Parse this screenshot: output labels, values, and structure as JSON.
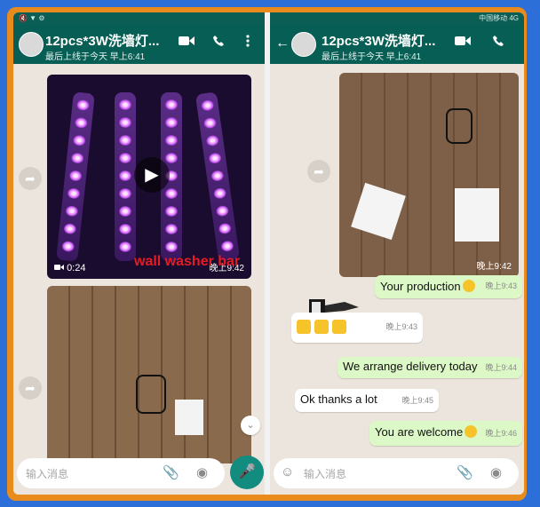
{
  "left_chat": {
    "status_bar": "🔇 ▼ ⚙",
    "header": {
      "title": "12pcs*3W洗墙灯...",
      "subtitle": "最后上线于今天 早上6:41"
    },
    "video": {
      "duration": "0:24",
      "time": "晚上9:42"
    },
    "caption": "wall washer bar",
    "input_placeholder": "输入消息"
  },
  "right_chat": {
    "status_bar": "中国移动 4G",
    "header": {
      "title": "12pcs*3W洗墙灯...",
      "subtitle": "最后上线于今天 早上6:41"
    },
    "image_time": "晚上9:42",
    "messages": [
      {
        "text": "Your production",
        "time": "晚上9:43"
      },
      {
        "text": "",
        "time": "晚上9:43"
      },
      {
        "text": "We arrange delivery today",
        "time": "晚上9:44"
      },
      {
        "text": "Ok thanks a lot",
        "time": "晚上9:45"
      },
      {
        "text": "You are welcome",
        "time": "晚上9:46"
      }
    ],
    "input_placeholder": "输入消息"
  },
  "colors": {
    "appbar": "#075e54",
    "outgoing_bubble": "#dcf8c6",
    "incoming_bubble": "#ffffff",
    "frame": "#e98a1c",
    "caption": "#e51c23"
  },
  "icons": [
    "back-arrow-icon",
    "video-call-icon",
    "phone-icon",
    "more-icon",
    "play-icon",
    "forward-icon",
    "attach-icon",
    "camera-icon",
    "mic-icon",
    "emoji-icon",
    "chevron-down-icon"
  ]
}
